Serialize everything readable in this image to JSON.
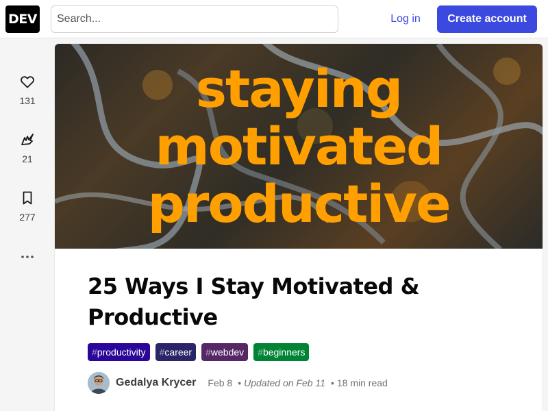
{
  "header": {
    "logo": "DEV",
    "search_placeholder": "Search...",
    "login_label": "Log in",
    "create_account_label": "Create account",
    "accent_color": "#3b49df"
  },
  "reactions": {
    "like": {
      "icon": "heart-icon",
      "count": "131"
    },
    "unicorn": {
      "icon": "unicorn-icon",
      "count": "21"
    },
    "save": {
      "icon": "bookmark-icon",
      "count": "277"
    },
    "more": {
      "icon": "more-dots-icon"
    }
  },
  "article": {
    "cover": {
      "lines": [
        "staying",
        "motivated",
        "productive"
      ],
      "text_color": "#ffa000"
    },
    "title": "25 Ways I Stay Motivated & Productive",
    "tags": [
      {
        "hash": "#",
        "name": "productivity",
        "color": "#2a0798"
      },
      {
        "hash": "#",
        "name": "career",
        "color": "#2a2566"
      },
      {
        "hash": "#",
        "name": "webdev",
        "color": "#562765"
      },
      {
        "hash": "#",
        "name": "beginners",
        "color": "#008335"
      }
    ],
    "author": "Gedalya Krycer",
    "date": "Feb 8",
    "separator": "•",
    "updated": "Updated on Feb 11",
    "read_time": "18 min read"
  }
}
